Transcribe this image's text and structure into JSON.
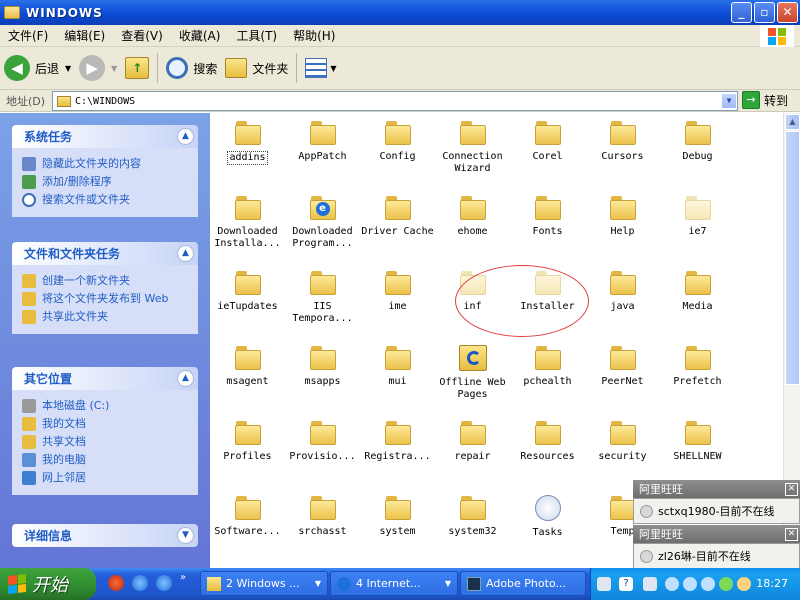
{
  "window": {
    "title": "WINDOWS"
  },
  "menu": [
    "文件(F)",
    "编辑(E)",
    "查看(V)",
    "收藏(A)",
    "工具(T)",
    "帮助(H)"
  ],
  "toolbar": {
    "back": "后退",
    "search": "搜索",
    "folders": "文件夹"
  },
  "address": {
    "label": "地址(D)",
    "value": "C:\\WINDOWS",
    "go": "转到"
  },
  "left": {
    "system_tasks": {
      "title": "系统任务",
      "items": [
        "隐藏此文件夹的内容",
        "添加/删除程序",
        "搜索文件或文件夹"
      ]
    },
    "file_tasks": {
      "title": "文件和文件夹任务",
      "items": [
        "创建一个新文件夹",
        "将这个文件夹发布到 Web",
        "共享此文件夹"
      ]
    },
    "other_places": {
      "title": "其它位置",
      "items": [
        "本地磁盘 (C:)",
        "我的文档",
        "共享文档",
        "我的电脑",
        "网上邻居"
      ]
    },
    "details": {
      "title": "详细信息"
    }
  },
  "files": [
    {
      "name": "addins"
    },
    {
      "name": "AppPatch"
    },
    {
      "name": "Config"
    },
    {
      "name": "Connection Wizard"
    },
    {
      "name": "Corel"
    },
    {
      "name": "Cursors"
    },
    {
      "name": "Debug"
    },
    {
      "name": "Downloaded Installa..."
    },
    {
      "name": "Downloaded Program..."
    },
    {
      "name": "Driver Cache"
    },
    {
      "name": "ehome"
    },
    {
      "name": "Fonts"
    },
    {
      "name": "Help"
    },
    {
      "name": "ie7"
    },
    {
      "name": "ieTupdates"
    },
    {
      "name": "IIS Tempora..."
    },
    {
      "name": "ime"
    },
    {
      "name": "inf"
    },
    {
      "name": "Installer"
    },
    {
      "name": "java"
    },
    {
      "name": "Media"
    },
    {
      "name": "msagent"
    },
    {
      "name": "msapps"
    },
    {
      "name": "mui"
    },
    {
      "name": "Offline Web Pages"
    },
    {
      "name": "pchealth"
    },
    {
      "name": "PeerNet"
    },
    {
      "name": "Prefetch"
    },
    {
      "name": "Profiles"
    },
    {
      "name": "Provisio..."
    },
    {
      "name": "Registra..."
    },
    {
      "name": "repair"
    },
    {
      "name": "Resources"
    },
    {
      "name": "security"
    },
    {
      "name": "SHELLNEW"
    },
    {
      "name": "Software..."
    },
    {
      "name": "srchasst"
    },
    {
      "name": "system"
    },
    {
      "name": "system32"
    },
    {
      "name": "Tasks"
    },
    {
      "name": "Temp"
    }
  ],
  "popups": [
    {
      "title": "阿里旺旺",
      "text": "sctxq1980-目前不在线"
    },
    {
      "title": "阿里旺旺",
      "text": "zl26琳-目前不在线"
    }
  ],
  "taskbar": {
    "start": "开始",
    "buttons": [
      "2 Windows ...",
      "4 Internet...",
      "Adobe Photo..."
    ],
    "clock": "18:27"
  },
  "colors": {
    "xp_blue": "#0a4bd6",
    "task_link": "#215dc6",
    "folder": "#ecc24b",
    "highlight_circle": "#e23b3b"
  }
}
